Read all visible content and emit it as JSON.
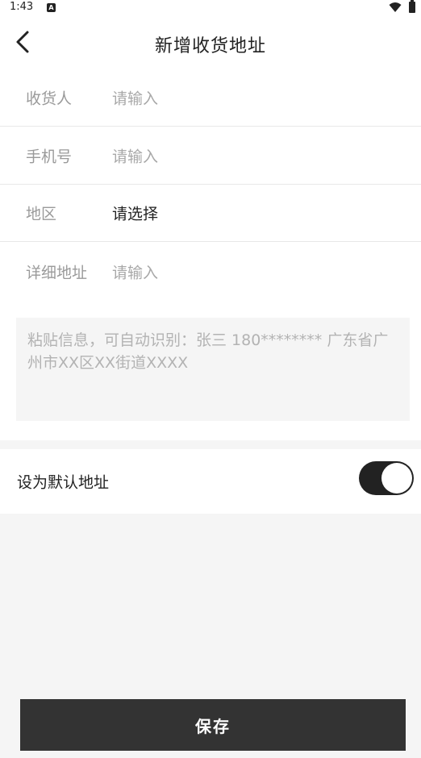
{
  "status_bar": {
    "time": "1:43",
    "notification_icon": "a-icon",
    "wifi_icon": "wifi-icon",
    "battery_icon": "battery-icon"
  },
  "header": {
    "back_icon": "chevron-left-icon",
    "title": "新增收货地址"
  },
  "form": {
    "rows": [
      {
        "label": "收货人",
        "value": "请输入"
      },
      {
        "label": "手机号",
        "value": "请输入"
      },
      {
        "label": "地区",
        "value": "请选择"
      },
      {
        "label": "详细地址",
        "value": "请输入"
      }
    ]
  },
  "paste": {
    "placeholder": "粘贴信息，可自动识别：张三 180******** 广东省广州市XX区XX街道XXXX"
  },
  "default_address": {
    "label": "设为默认地址",
    "enabled": true
  },
  "save": {
    "label": "保存"
  },
  "colors": {
    "accent": "#333333",
    "toggle_on": "#222222",
    "background": "#f5f5f5"
  }
}
